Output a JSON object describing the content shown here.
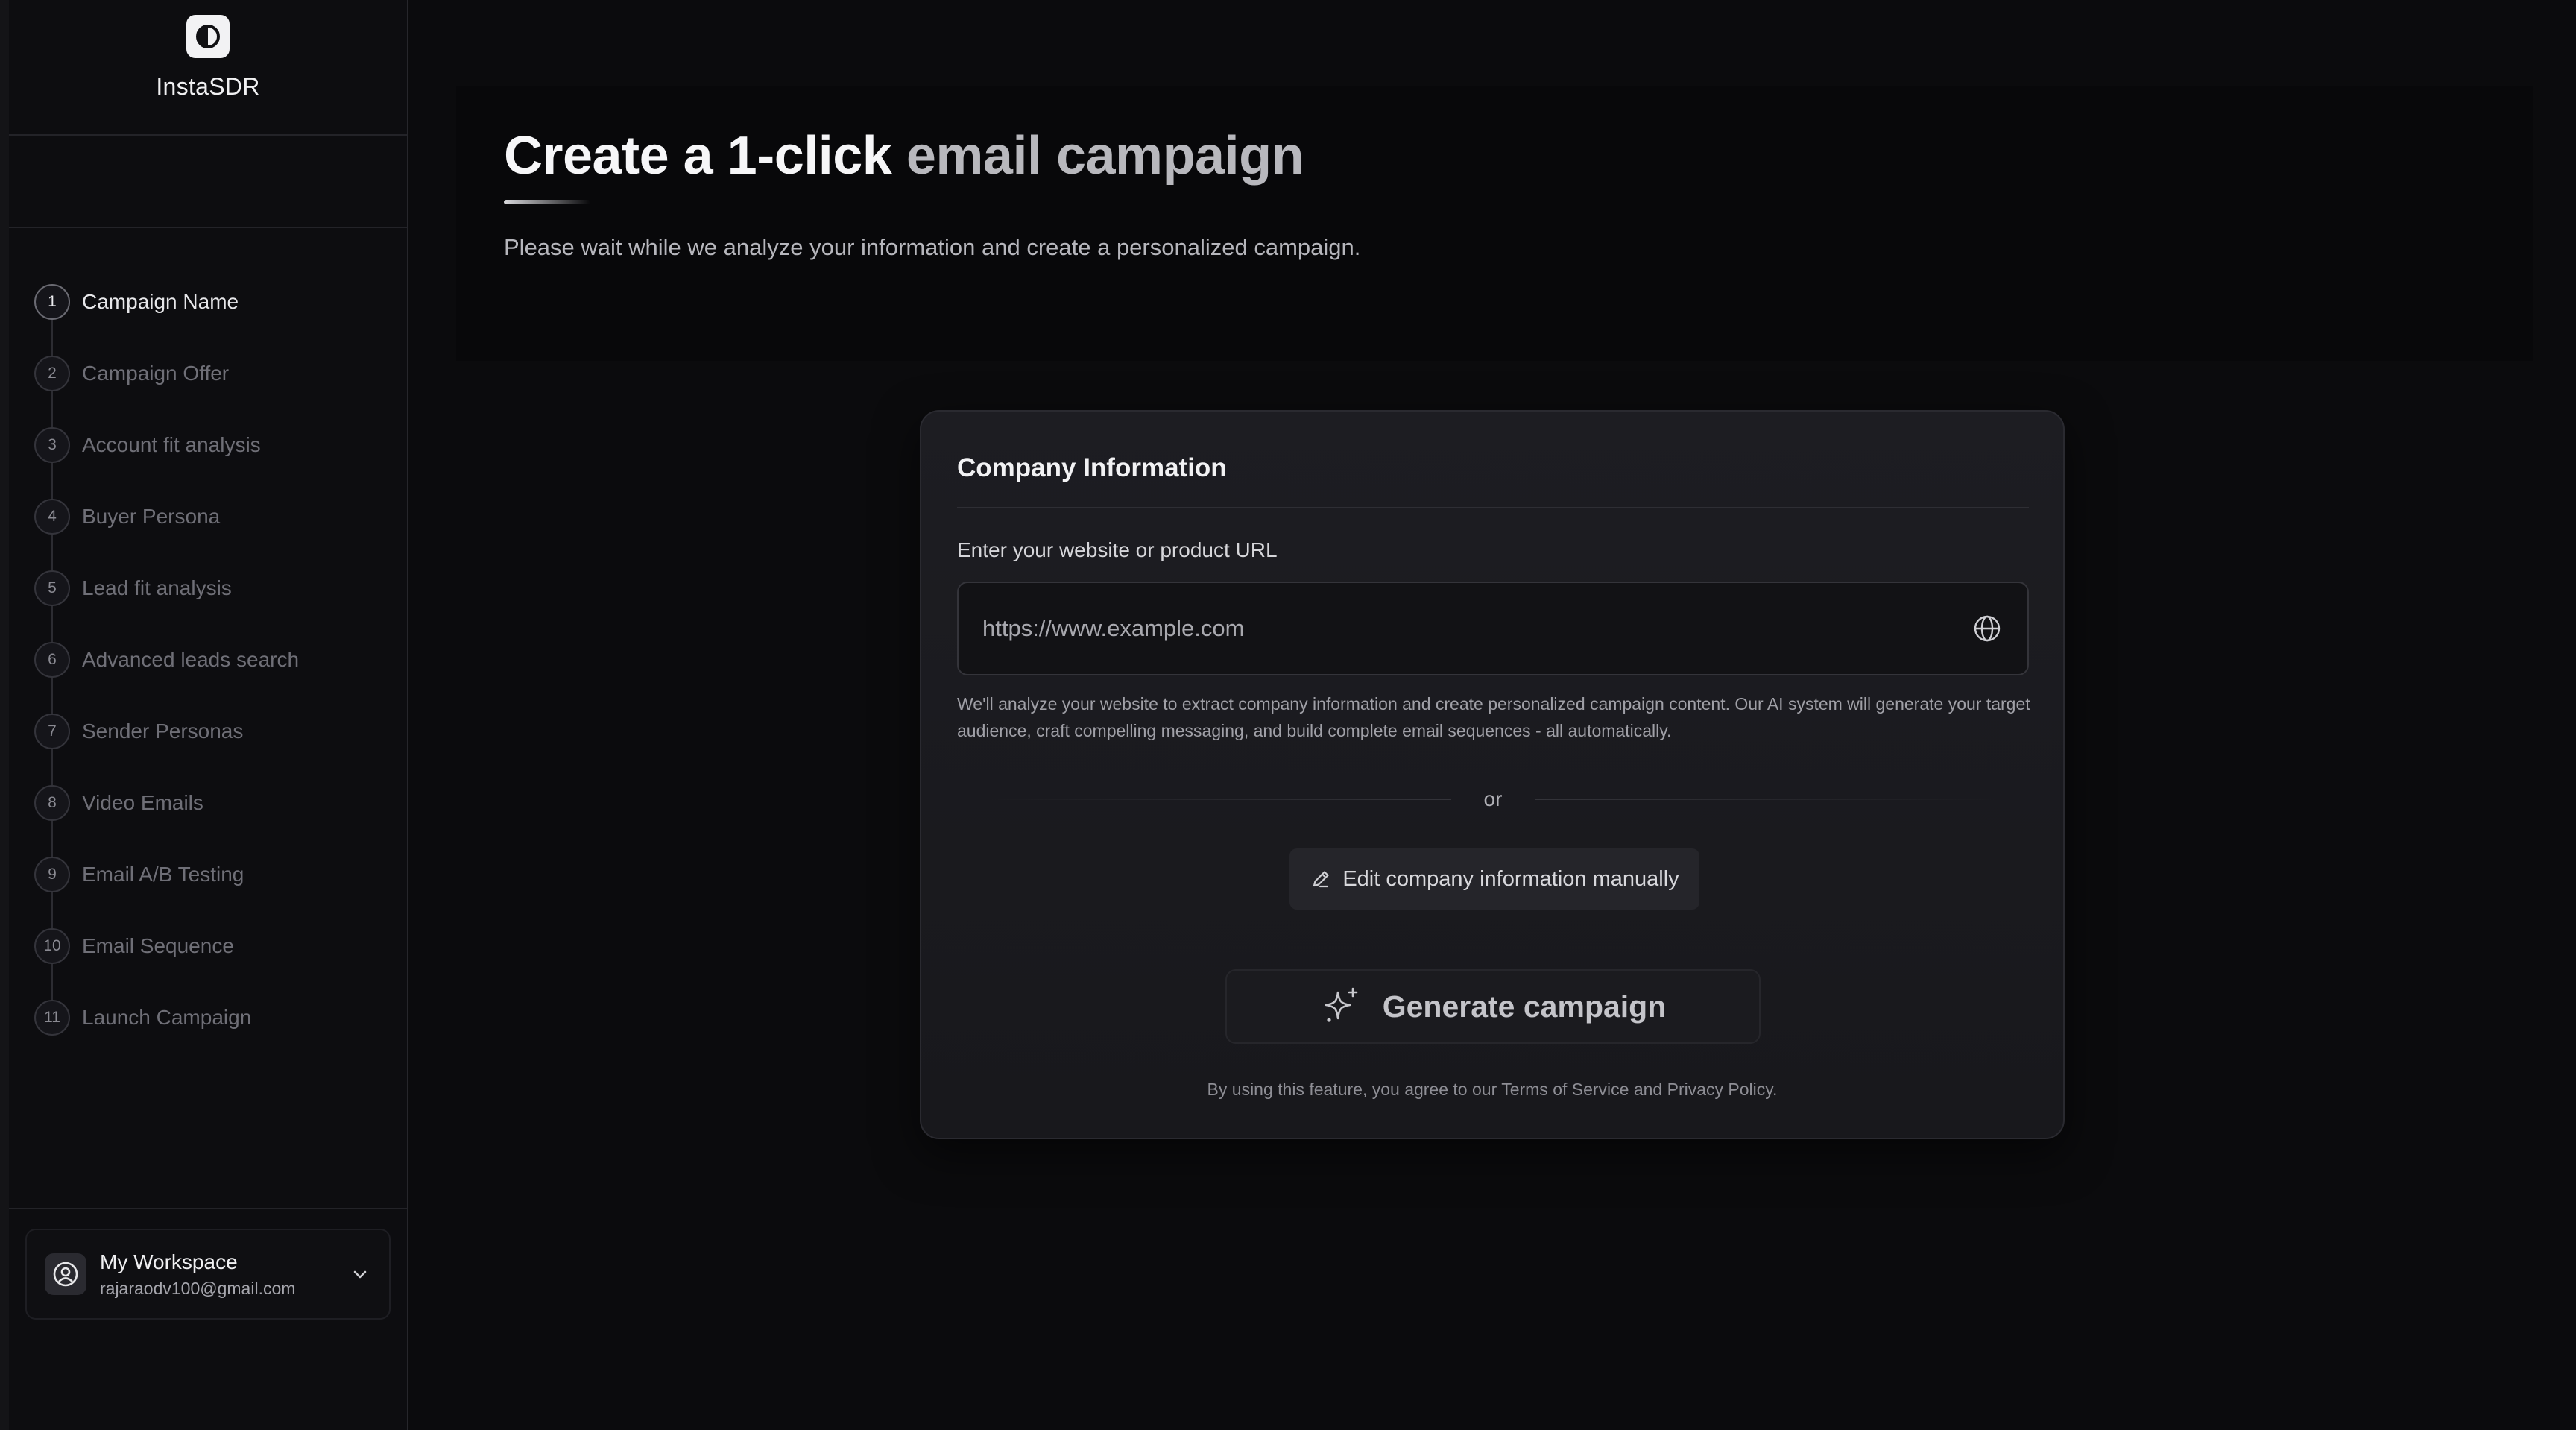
{
  "brand": {
    "name": "InstaSDR",
    "logo_icon": "contrast-circle-icon"
  },
  "steps": [
    {
      "num": "1",
      "label": "Campaign Name",
      "active": true
    },
    {
      "num": "2",
      "label": "Campaign Offer",
      "active": false
    },
    {
      "num": "3",
      "label": "Account fit analysis",
      "active": false
    },
    {
      "num": "4",
      "label": "Buyer Persona",
      "active": false
    },
    {
      "num": "5",
      "label": "Lead fit analysis",
      "active": false
    },
    {
      "num": "6",
      "label": "Advanced leads search",
      "active": false
    },
    {
      "num": "7",
      "label": "Sender Personas",
      "active": false
    },
    {
      "num": "8",
      "label": "Video Emails",
      "active": false
    },
    {
      "num": "9",
      "label": "Email A/B Testing",
      "active": false
    },
    {
      "num": "10",
      "label": "Email Sequence",
      "active": false
    },
    {
      "num": "11",
      "label": "Launch Campaign",
      "active": false
    }
  ],
  "workspace": {
    "name": "My Workspace",
    "email": "rajaraodv100@gmail.com",
    "avatar_icon": "user-circle-icon",
    "chevron_icon": "chevron-down-icon"
  },
  "hero": {
    "title_bright": "Create a 1-click",
    "title_muted": "email campaign",
    "subtitle": "Please wait while we analyze your information and create a personalized campaign."
  },
  "card": {
    "title": "Company Information",
    "url_label": "Enter your website or product URL",
    "url_value": "",
    "url_placeholder": "https://www.example.com",
    "help_text": "We'll analyze your website to extract company information and create personalized campaign content. Our AI system will generate your target audience, craft compelling messaging, and build complete email sequences - all automatically.",
    "or_text": "or",
    "edit_label": "Edit company information manually",
    "generate_label": "Generate campaign",
    "legal_text": "By using this feature, you agree to our Terms of Service and Privacy Policy."
  },
  "colors": {
    "background": "#0b0b0d",
    "card": "#1b1b20",
    "text_primary": "#f2f2f4",
    "text_muted": "#6f6f77"
  }
}
